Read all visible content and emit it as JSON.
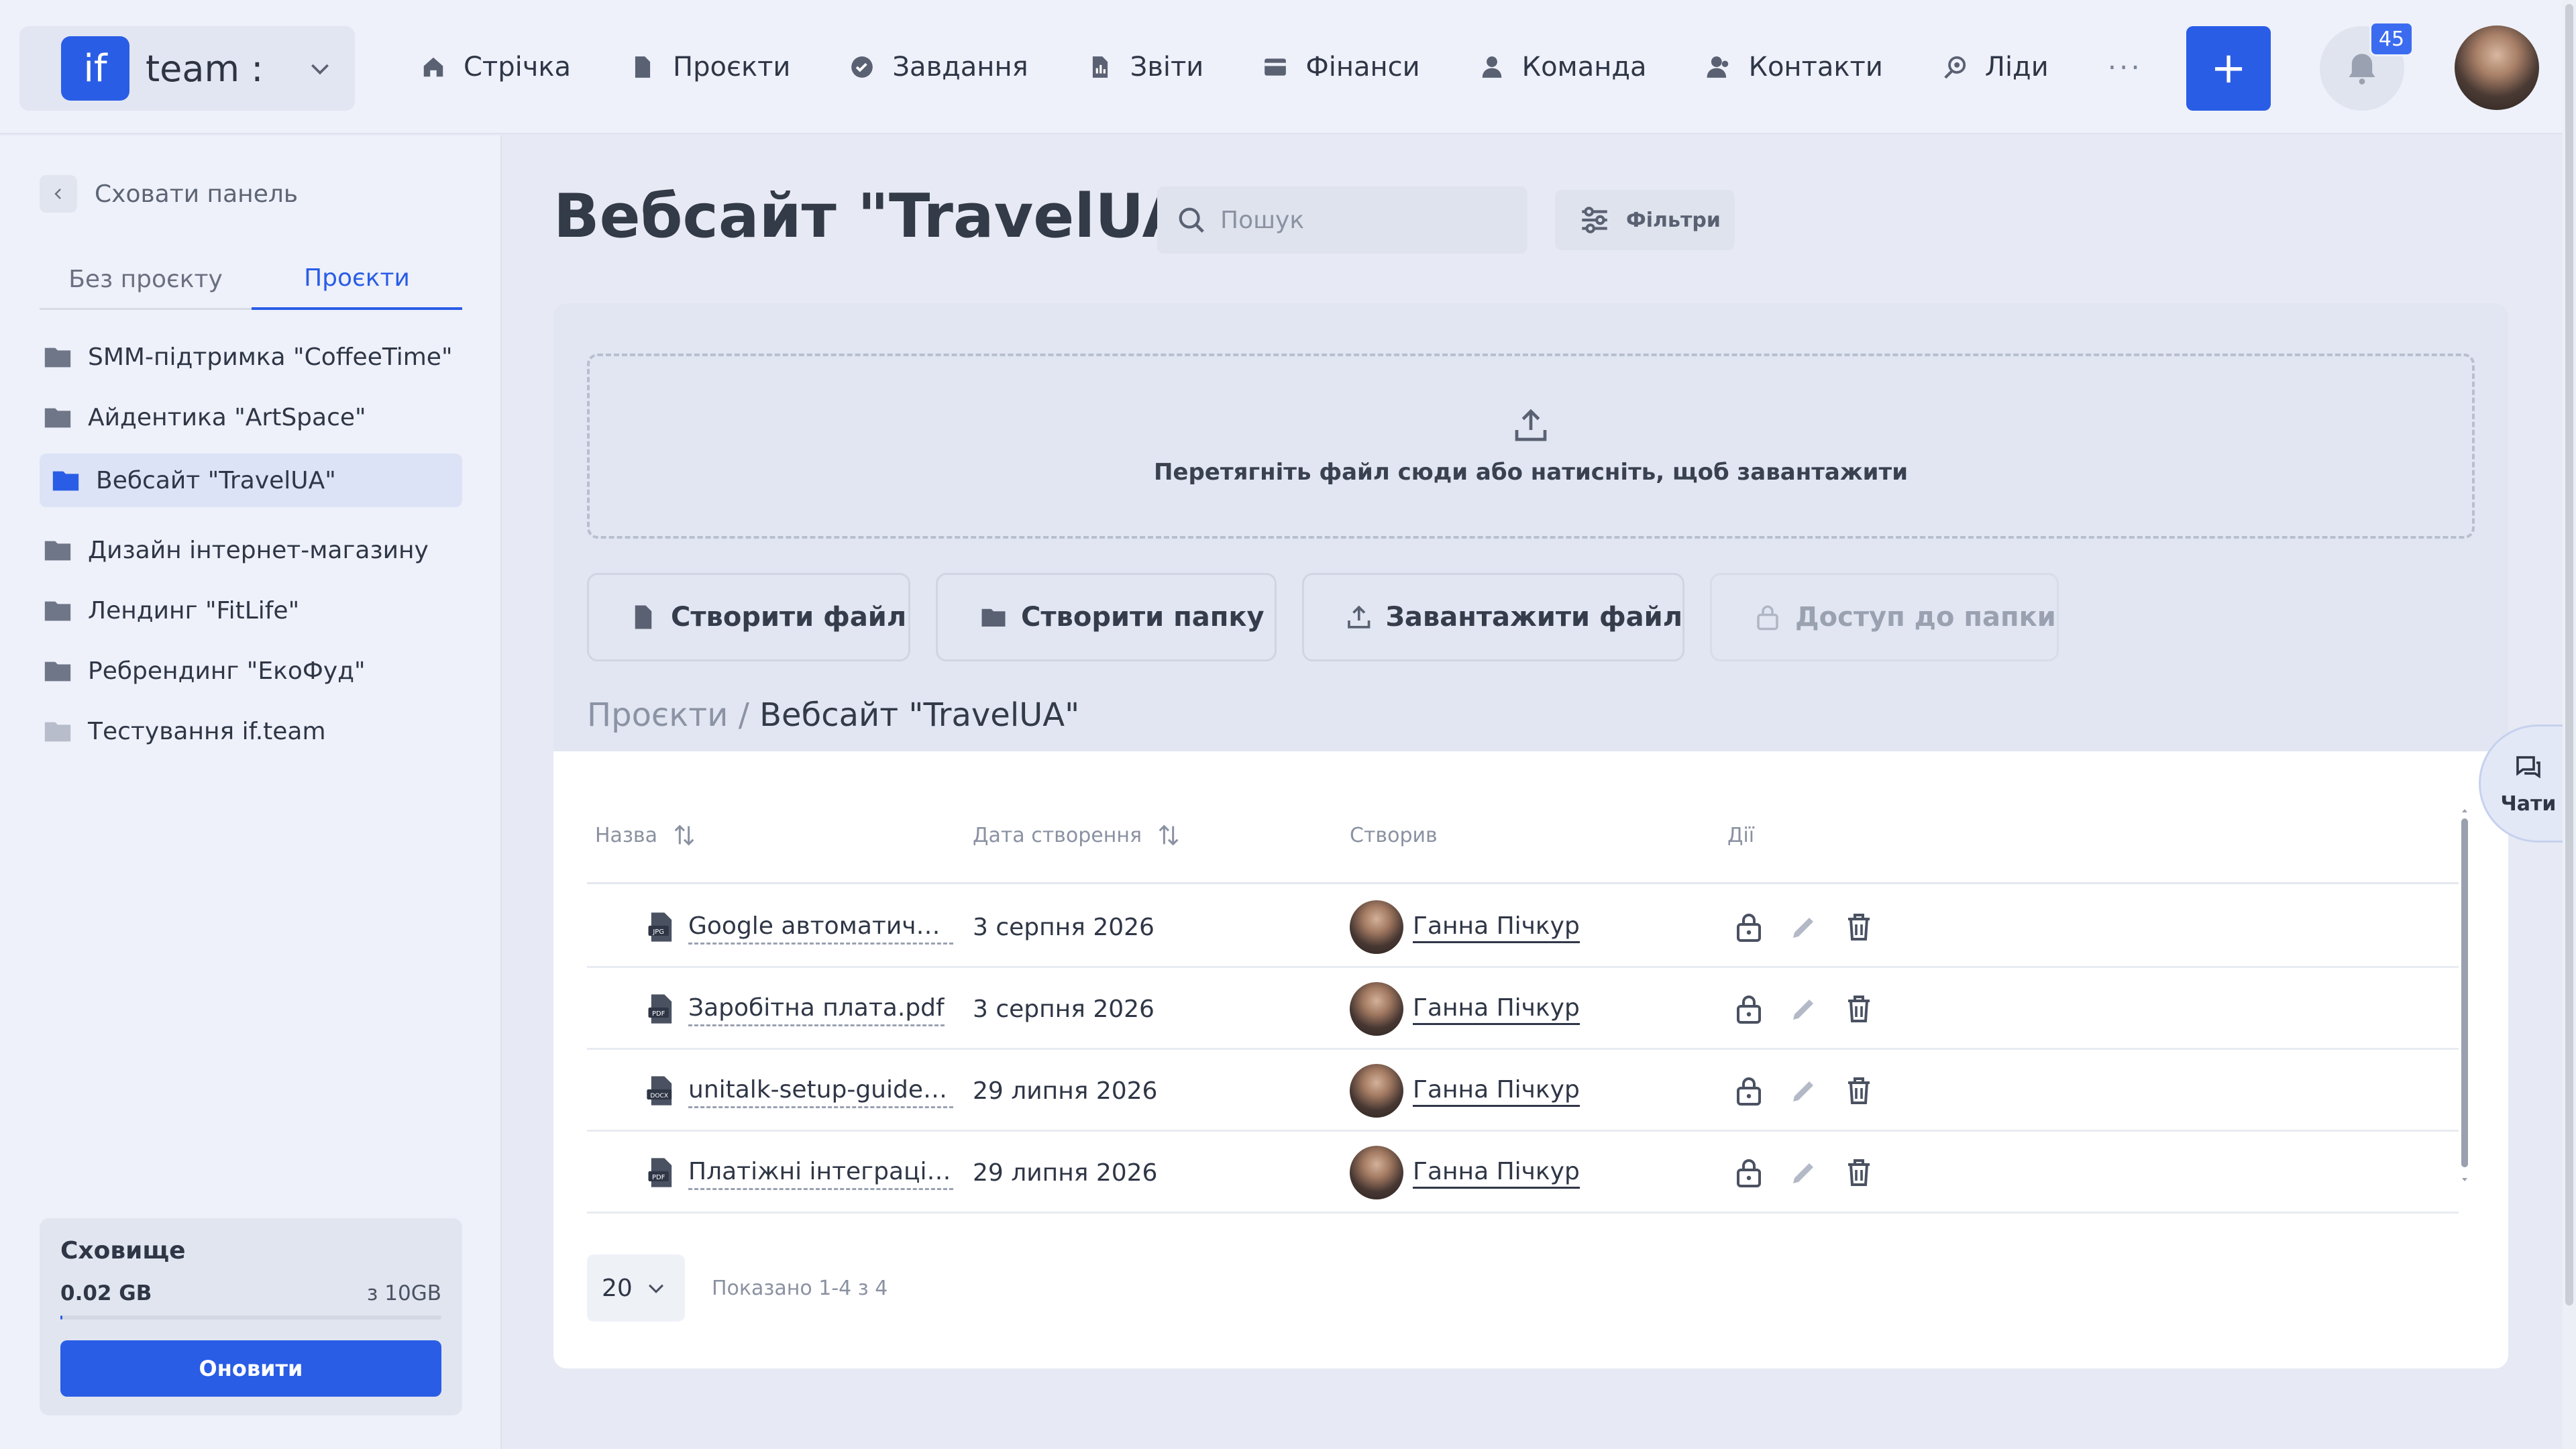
{
  "brand": {
    "logo": "if",
    "name": "team :"
  },
  "nav": [
    {
      "label": "Стрічка",
      "icon": "home-icon"
    },
    {
      "label": "Проєкти",
      "icon": "file-icon"
    },
    {
      "label": "Завдання",
      "icon": "check-circle-icon"
    },
    {
      "label": "Звіти",
      "icon": "report-icon"
    },
    {
      "label": "Фінанси",
      "icon": "wallet-icon"
    },
    {
      "label": "Команда",
      "icon": "user-icon"
    },
    {
      "label": "Контакти",
      "icon": "contacts-icon"
    },
    {
      "label": "Ліди",
      "icon": "leads-icon"
    }
  ],
  "nav_more": "···",
  "top_actions": {
    "add_label": "+",
    "notifications_count": "45"
  },
  "sidebar": {
    "hide_label": "Сховати панель",
    "tabs": [
      "Без проєкту",
      "Проєкти"
    ],
    "active_tab": "Проєкти",
    "projects": [
      "SMM-підтримка \"CoffeeTime\"",
      "Айдентика \"ArtSpace\"",
      "Вебсайт \"TravelUA\"",
      "Дизайн інтернет-магазину",
      "Лендинг \"FitLife\"",
      "Ребрендинг \"ЕкоФуд\"",
      "Тестування if.team"
    ],
    "active_project": "Вебсайт \"TravelUA\"",
    "storage": {
      "title": "Сховище",
      "used": "0.02 GB",
      "total": "з 10GB",
      "used_fraction": 0.002,
      "button": "Оновити"
    }
  },
  "main": {
    "title": "Вебсайт \"TravelUA\"",
    "search_placeholder": "Пошук",
    "filters_label": "Фільтри",
    "dropzone_text": "Перетягніть файл сюди або натисніть, щоб завантажити",
    "actions": [
      "Створити файл",
      "Створити папку",
      "Завантажити файл",
      "Доступ до папки"
    ],
    "breadcrumb": {
      "root": "Проєкти",
      "sep": "/",
      "current": "Вебсайт \"TravelUA\""
    },
    "table": {
      "columns": [
        "Назва",
        "Дата створення",
        "Створив",
        "Дії"
      ],
      "rows": [
        {
          "type": "JPG",
          "name": "Google автоматично в...",
          "date": "3 серпня 2026",
          "author": "Ганна Пічкур"
        },
        {
          "type": "PDF",
          "name": "Заробітна плата.pdf",
          "date": "3 серпня 2026",
          "author": "Ганна Пічкур"
        },
        {
          "type": "DOCX",
          "name": "unitalk-setup-guide.d...",
          "date": "29 липня 2026",
          "author": "Ганна Пічкур"
        },
        {
          "type": "PDF",
          "name": "Платіжні інтеграції.pdf",
          "date": "29 липня 2026",
          "author": "Ганна Пічкур"
        }
      ]
    },
    "page_size": "20",
    "shown_text": "Показано 1-4 з 4"
  },
  "chats_label": "Чати",
  "colors": {
    "accent": "#2a5de6",
    "background": "#e7eaf4",
    "panel": "#e2e6f2"
  }
}
